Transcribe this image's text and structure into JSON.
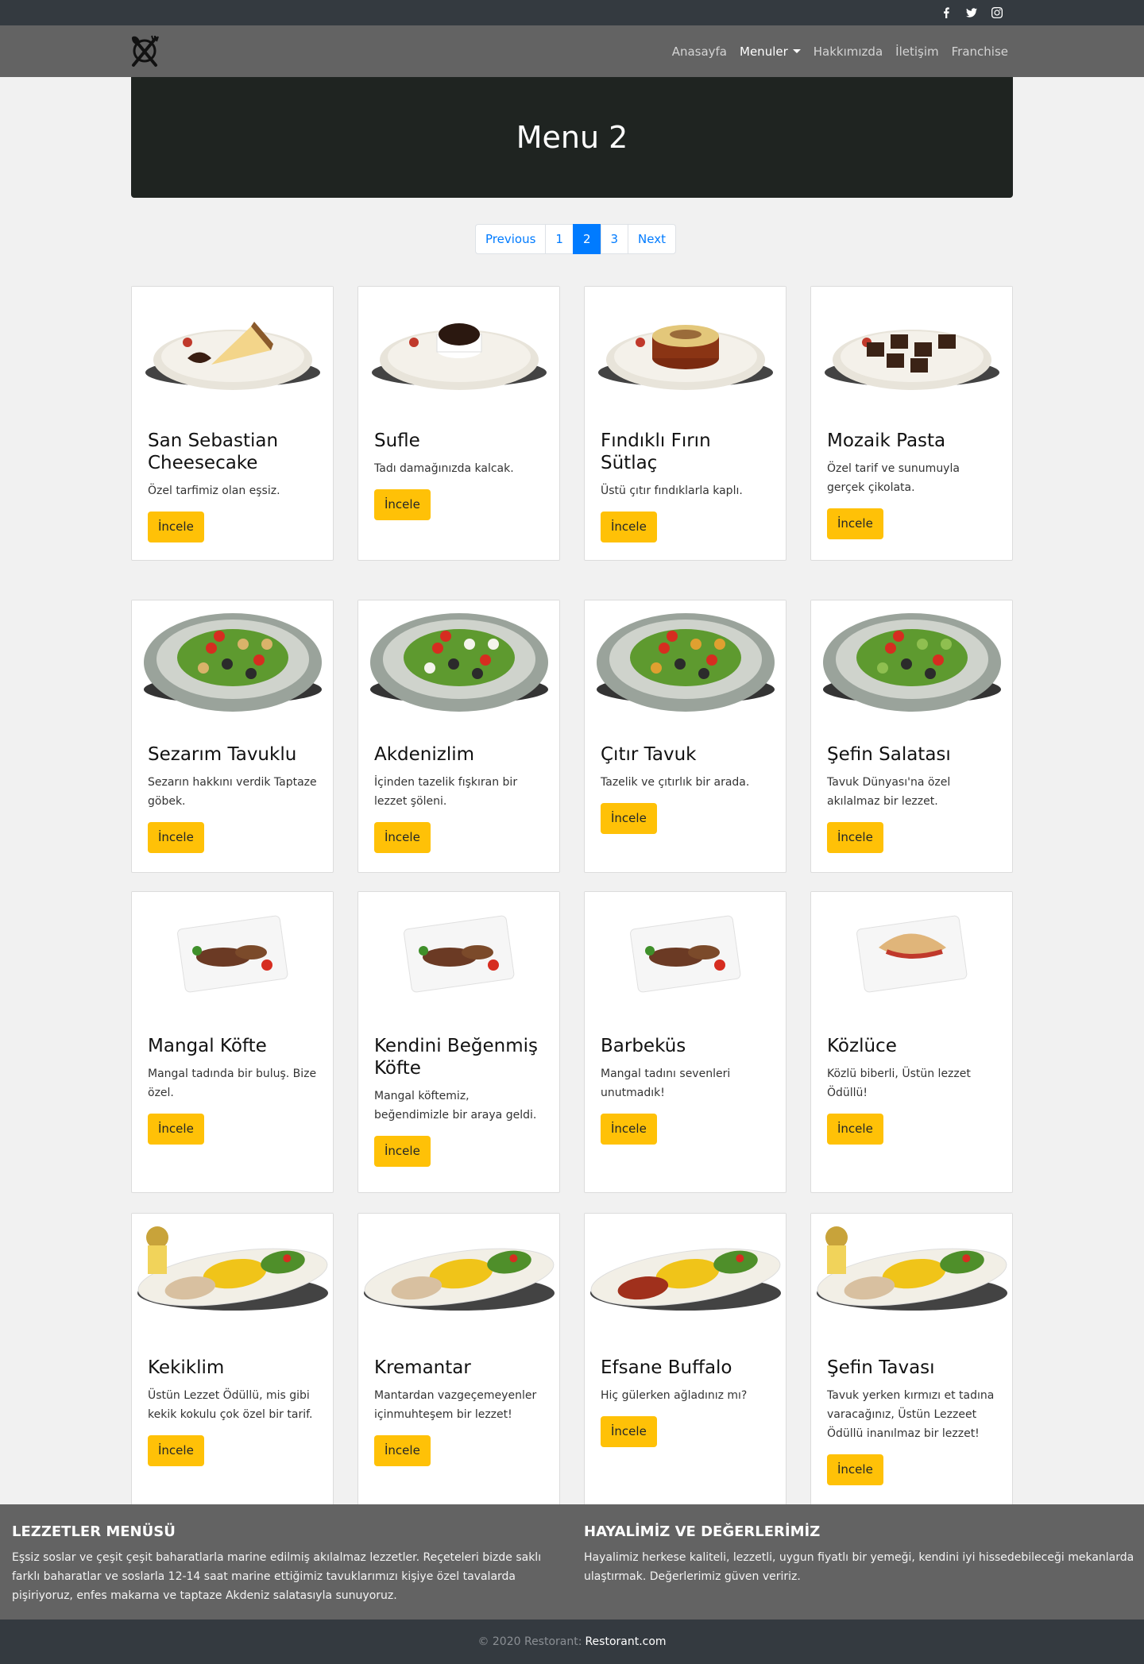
{
  "nav": {
    "items": [
      "Anasayfa",
      "Menuler",
      "Hakkımızda",
      "İletişim",
      "Franchise"
    ],
    "social": [
      "facebook-icon",
      "twitter-icon",
      "instagram-icon"
    ]
  },
  "hero": {
    "title": "Menu 2"
  },
  "pagination": {
    "previous": "Previous",
    "pages": [
      "1",
      "2",
      "3"
    ],
    "active_page": "2",
    "next": "Next"
  },
  "cards": [
    {
      "title": "San Sebastian Cheesecake",
      "text": "Özel tarfimiz olan eşsiz.",
      "button": "İncele"
    },
    {
      "title": "Sufle",
      "text": "Tadı damağınızda kalcak.",
      "button": "İncele"
    },
    {
      "title": "Fındıklı Fırın Sütlaç",
      "text": "Üstü çıtır fındıklarla kaplı.",
      "button": "İncele"
    },
    {
      "title": "Mozaik Pasta",
      "text": "Özel tarif ve sunumuyla gerçek çikolata.",
      "button": "İncele"
    },
    {
      "title": "Sezarım Tavuklu",
      "text": "Sezarın hakkını verdik Taptaze göbek.",
      "button": "İncele"
    },
    {
      "title": "Akdenizlim",
      "text": "İçinden tazelik fışkıran bir lezzet şöleni.",
      "button": "İncele"
    },
    {
      "title": "Çıtır Tavuk",
      "text": "Tazelik ve çıtırlık bir arada.",
      "button": "İncele"
    },
    {
      "title": "Şefin Salatası",
      "text": "Tavuk Dünyası'na özel akılalmaz bir lezzet.",
      "button": "İncele"
    },
    {
      "title": "Mangal Köfte",
      "text": "Mangal tadında bir buluş. Bize özel.",
      "button": "İncele"
    },
    {
      "title": "Kendini Beğenmiş Köfte",
      "text": "Mangal köftemiz, beğendimizle bir araya geldi.",
      "button": "İncele"
    },
    {
      "title": "Barbeküs",
      "text": "Mangal tadını sevenleri unutmadık!",
      "button": "İncele"
    },
    {
      "title": "Közlüce",
      "text": "Közlü biberli, Üstün lezzet Ödüllü!",
      "button": "İncele"
    },
    {
      "title": "Kekiklim",
      "text": "Üstün Lezzet Ödüllü, mis gibi kekik kokulu çok özel bir tarif.",
      "button": "İncele"
    },
    {
      "title": "Kremantar",
      "text": "Mantardan vazgeçemeyenler içinmuhteşem bir lezzet!",
      "button": "İncele"
    },
    {
      "title": "Efsane Buffalo",
      "text": "Hiç gülerken ağladınız mı?",
      "button": "İncele"
    },
    {
      "title": "Şefin Tavası",
      "text": "Tavuk yerken kırmızı et tadına varacağınız, Üstün Lezzeet Ödüllü inanılmaz bir lezzet!",
      "button": "İncele"
    }
  ],
  "footer": {
    "col1_title": "LEZZETLER MENÜSÜ",
    "col1_text": "Eşsiz soslar ve çeşit çeşit baharatlarla marine edilmiş akılalmaz lezzetler. Reçeteleri bizde saklı farklı baharatlar ve soslarla 12-14 saat marine ettiğimiz tavuklarımızı kişiye özel tavalarda pişiriyoruz, enfes makarna ve taptaze Akdeniz salatasıyla sunuyoruz.",
    "col2_title": "HAYALİMİZ VE DEĞERLERİMİZ",
    "col2_text": "Hayalimiz herkese kaliteli, lezzetli, uygun fiyatlı bir yemeği, kendini iyi hissedebileceği mekanlarda ulaştırmak. Değerlerimiz güven veririz.",
    "copyright": "© 2020 Restorant:",
    "copyright_link": "Restorant.com"
  }
}
